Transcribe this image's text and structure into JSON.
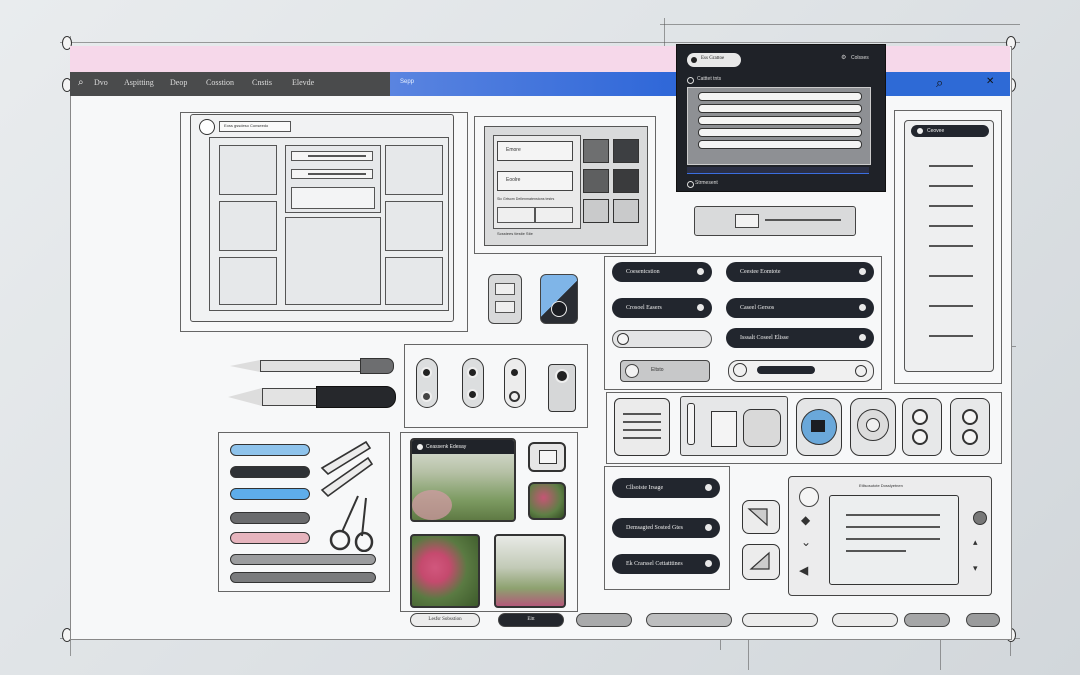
{
  "nav": {
    "items": [
      "Dvo",
      "Aspitting",
      "Deop",
      "Cosstion",
      "Cnstis",
      "Elevde"
    ],
    "search_label": "search-icon"
  },
  "blue_bar": {
    "label": "Sepp"
  },
  "top_dialog": {
    "field_label": "Ess Grattoe",
    "header_right": "Colsses",
    "header_left": "Catttet tnts",
    "footer": "Strmesent"
  },
  "left_window": {
    "title": "Eoss gssdeso Conseedo"
  },
  "mid_window": {
    "field1": "Emore",
    "field2": "Eoolre",
    "row_label": "Sic Grtsom Dellenmatenstons testrs",
    "footer_label": "Scsstees tlestie Stie"
  },
  "right_list": {
    "header": "Ceovee"
  },
  "pills_left": [
    "Coesentcstion",
    "Crosoel Easers"
  ],
  "pills_right": [
    "Ceestee Eomtote",
    "Caseel Gersos",
    "Isssalt Coseel Elisse"
  ],
  "toggle_label": "Eltsto",
  "gallery": {
    "title": "Ceassenk Edesay"
  },
  "pills_lower": [
    "Cllsoiste Irsage",
    "Demsagted Sosted Gtes",
    "Ek Crarssel Cettatttines"
  ],
  "bottom_buttons": [
    "Lesfsr Sobsstion",
    "Eltt"
  ],
  "doc_card": {
    "title": "Etllsosutote Dosslyetnen"
  },
  "icons": [
    "search-icon",
    "close-icon",
    "play-icon",
    "pen-icon",
    "scissors-icon",
    "gear-icon"
  ]
}
